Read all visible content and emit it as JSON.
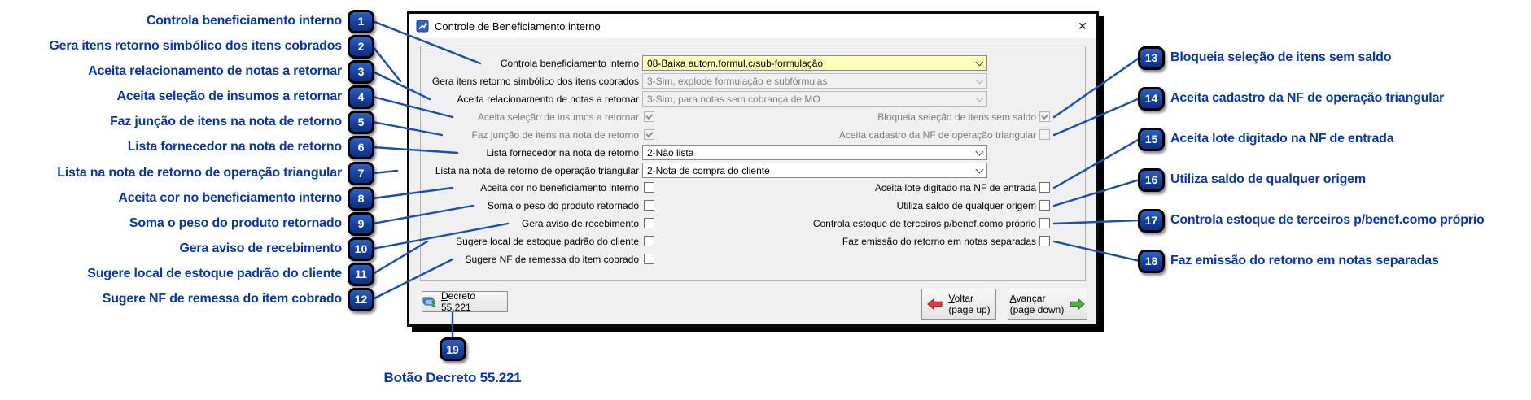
{
  "window": {
    "title": "Controle de Beneficiamento interno",
    "close_icon": "✕"
  },
  "form": {
    "rows": [
      {
        "label": "Controla beneficiamento interno",
        "value": "08-Baixa autom.formul.c/sub-formulação",
        "state": "highlighted"
      },
      {
        "label": "Gera itens retorno simbólico dos itens cobrados",
        "value": "3-Sim, explode formulação e subfórmulas",
        "state": "disabled"
      },
      {
        "label": "Aceita relacionamento de notas a retornar",
        "value": "3-Sim, para notas sem cobrança de MO",
        "state": "disabled"
      },
      {
        "left_label": "Aceita seleção de insumos a retornar",
        "left_checked": true,
        "right_label": "Bloqueia seleção de itens sem saldo",
        "right_checked": true,
        "state": "disabled"
      },
      {
        "left_label": "Faz junção de itens na nota de retorno",
        "left_checked": true,
        "right_label": "Aceita cadastro da NF de operação triangular",
        "right_checked": false,
        "state": "disabled"
      },
      {
        "label": "Lista fornecedor na nota de retorno",
        "value": "2-Não lista",
        "state": "enabled"
      },
      {
        "label": "Lista na nota de retorno de operação triangular",
        "value": "2-Nota de compra do cliente",
        "state": "enabled"
      },
      {
        "left_label": "Aceita cor no beneficiamento interno",
        "left_checked": false,
        "right_label": "Aceita lote digitado na NF de entrada",
        "right_checked": false,
        "state": "enabled"
      },
      {
        "left_label": "Soma o peso do produto retornado",
        "left_checked": false,
        "right_label": "Utiliza saldo de qualquer origem",
        "right_checked": false,
        "state": "enabled"
      },
      {
        "left_label": "Gera aviso de recebimento",
        "left_checked": false,
        "right_label": "Controla estoque de terceiros p/benef.como próprio",
        "right_checked": false,
        "state": "enabled"
      },
      {
        "left_label": "Sugere local de estoque padrão do cliente",
        "left_checked": false,
        "right_label": "Faz emissão do retorno em notas separadas",
        "right_checked": false,
        "state": "enabled"
      },
      {
        "left_label": "Sugere NF de remessa do item cobrado",
        "left_checked": false,
        "state": "enabled"
      }
    ]
  },
  "buttons": {
    "decreto": {
      "mn": "D",
      "rest": "ecreto 55.221"
    },
    "voltar": {
      "mn": "V",
      "rest": "oltar",
      "sub": "(page up)"
    },
    "avancar": {
      "mn": "A",
      "rest": "vançar",
      "sub": "(page down)"
    }
  },
  "annotations": {
    "left": [
      {
        "num": "1",
        "label": "Controla beneficiamento interno"
      },
      {
        "num": "2",
        "label": "Gera itens retorno simbólico dos itens cobrados"
      },
      {
        "num": "3",
        "label": "Aceita relacionamento de notas a retornar"
      },
      {
        "num": "4",
        "label": "Aceita seleção de insumos a retornar"
      },
      {
        "num": "5",
        "label": "Faz junção de itens na nota de retorno"
      },
      {
        "num": "6",
        "label": "Lista fornecedor na nota de retorno"
      },
      {
        "num": "7",
        "label": "Lista na nota de retorno de operação triangular"
      },
      {
        "num": "8",
        "label": "Aceita cor no beneficiamento interno"
      },
      {
        "num": "9",
        "label": "Soma o peso do produto retornado"
      },
      {
        "num": "10",
        "label": "Gera aviso de recebimento"
      },
      {
        "num": "11",
        "label": "Sugere local de estoque padrão do cliente"
      },
      {
        "num": "12",
        "label": "Sugere NF de remessa do item cobrado"
      }
    ],
    "right": [
      {
        "num": "13",
        "label": "Bloqueia seleção de itens sem saldo"
      },
      {
        "num": "14",
        "label": "Aceita cadastro da NF de operação triangular"
      },
      {
        "num": "15",
        "label": "Aceita lote digitado na NF de entrada"
      },
      {
        "num": "16",
        "label": "Utiliza saldo de qualquer origem"
      },
      {
        "num": "17",
        "label": "Controla estoque de terceiros p/benef.como próprio"
      },
      {
        "num": "18",
        "label": "Faz emissão do retorno em notas separadas"
      }
    ],
    "bottom": {
      "num": "19",
      "label": "Botão Decreto 55.221"
    }
  },
  "colors": {
    "annotation_blue": "#0a36a3",
    "badge_blue": "#16409f",
    "connector_blue": "#1d4da9",
    "combo_highlight": "#ffffbd",
    "voltar_arrow_red": "#e23b3b",
    "avancar_arrow_green": "#4db43c"
  }
}
